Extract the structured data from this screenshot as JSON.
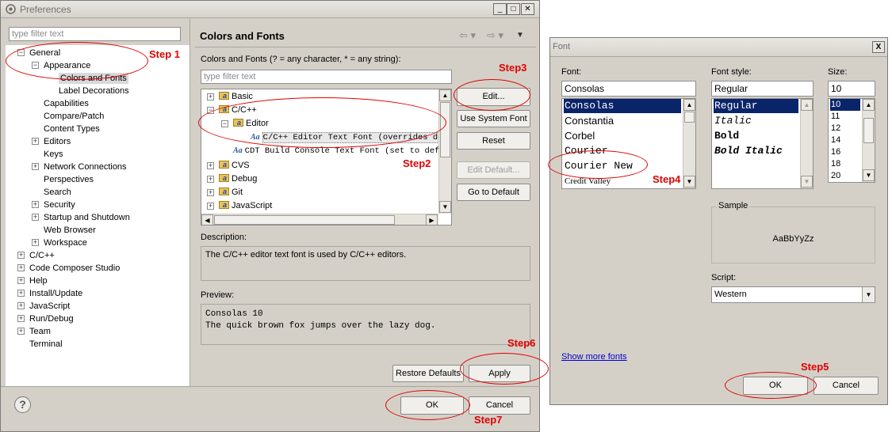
{
  "preferences": {
    "title": "Preferences",
    "filter_placeholder": "type filter text",
    "tree": [
      {
        "label": "General",
        "expander": "minus"
      },
      {
        "label": "Appearance",
        "expander": "minus"
      },
      {
        "label": "Colors and Fonts",
        "expander": "none",
        "selected": true
      },
      {
        "label": "Label Decorations",
        "expander": "none"
      },
      {
        "label": "Capabilities",
        "expander": "none"
      },
      {
        "label": "Compare/Patch",
        "expander": "none"
      },
      {
        "label": "Content Types",
        "expander": "none"
      },
      {
        "label": "Editors",
        "expander": "plus"
      },
      {
        "label": "Keys",
        "expander": "none"
      },
      {
        "label": "Network Connections",
        "expander": "plus"
      },
      {
        "label": "Perspectives",
        "expander": "none"
      },
      {
        "label": "Search",
        "expander": "none"
      },
      {
        "label": "Security",
        "expander": "plus"
      },
      {
        "label": "Startup and Shutdown",
        "expander": "plus"
      },
      {
        "label": "Web Browser",
        "expander": "none"
      },
      {
        "label": "Workspace",
        "expander": "plus"
      },
      {
        "label": "C/C++",
        "expander": "plus"
      },
      {
        "label": "Code Composer Studio",
        "expander": "plus"
      },
      {
        "label": "Help",
        "expander": "plus"
      },
      {
        "label": "Install/Update",
        "expander": "plus"
      },
      {
        "label": "JavaScript",
        "expander": "plus"
      },
      {
        "label": "Run/Debug",
        "expander": "plus"
      },
      {
        "label": "Team",
        "expander": "plus"
      },
      {
        "label": "Terminal",
        "expander": "none"
      }
    ],
    "page_title": "Colors and Fonts",
    "page_hint": "Colors and Fonts (? = any character, * = any string):",
    "page_filter_placeholder": "type filter text",
    "font_tree": [
      {
        "label": "Basic",
        "kind": "folder",
        "expander": "plus"
      },
      {
        "label": "C/C++",
        "kind": "folder",
        "expander": "minus"
      },
      {
        "label": "Editor",
        "kind": "folder",
        "expander": "minus"
      },
      {
        "label": "C/C++ Editor Text Font (overrides de",
        "kind": "font"
      },
      {
        "label": "CDT Build Console Text Font (set to def",
        "kind": "font"
      },
      {
        "label": "CVS",
        "kind": "folder",
        "expander": "plus"
      },
      {
        "label": "Debug",
        "kind": "folder",
        "expander": "plus"
      },
      {
        "label": "Git",
        "kind": "folder",
        "expander": "plus"
      },
      {
        "label": "JavaScript",
        "kind": "folder",
        "expander": "plus"
      }
    ],
    "buttons": {
      "edit": "Edit...",
      "use_system_font": "Use System Font",
      "reset": "Reset",
      "edit_default": "Edit Default...",
      "go_to_default": "Go to Default",
      "restore_defaults": "Restore Defaults",
      "apply": "Apply",
      "ok": "OK",
      "cancel": "Cancel"
    },
    "description_label": "Description:",
    "description_text": "The C/C++ editor text font is used by C/C++ editors.",
    "preview_label": "Preview:",
    "preview_line1": "Consolas 10",
    "preview_line2": "The quick brown fox jumps over the lazy dog.",
    "help_icon_glyph": "?",
    "nav_icons": [
      "back-arrow-icon",
      "forward-arrow-icon",
      "view-menu-icon"
    ]
  },
  "font_dialog": {
    "title": "Font",
    "font_label": "Font:",
    "font_value": "Consolas",
    "fonts": [
      "Consolas",
      "Constantia",
      "Corbel",
      "Courier",
      "Courier New",
      "Credit Valley"
    ],
    "style_label": "Font style:",
    "style_value": "Regular",
    "styles": [
      "Regular",
      "Italic",
      "Bold",
      "Bold Italic"
    ],
    "size_label": "Size:",
    "size_value": "10",
    "sizes": [
      "10",
      "11",
      "12",
      "14",
      "16",
      "18",
      "20"
    ],
    "sample_label": "Sample",
    "sample_text": "AaBbYyZz",
    "script_label": "Script:",
    "script_value": "Western",
    "show_more_fonts": "Show more fonts",
    "ok": "OK",
    "cancel": "Cancel",
    "close_glyph": "X"
  },
  "annotations": {
    "step1": "Step 1",
    "step2": "Step2",
    "step3": "Step3",
    "step4": "Step4",
    "step5": "Step5",
    "step6": "Step6",
    "step7": "Step7",
    "color": "#e00000"
  }
}
